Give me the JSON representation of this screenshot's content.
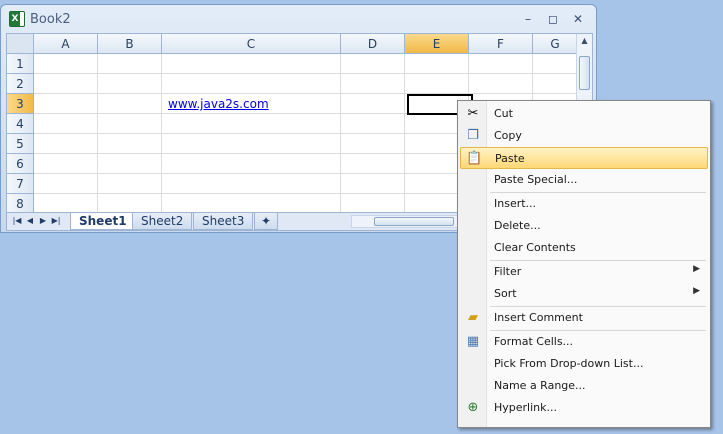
{
  "window": {
    "title": "Book2",
    "buttons": [
      "–",
      "◻",
      "✕"
    ]
  },
  "grid": {
    "columns": [
      "A",
      "B",
      "C",
      "D",
      "E",
      "F",
      "G"
    ],
    "rows": [
      "1",
      "2",
      "3",
      "4",
      "5",
      "6",
      "7",
      "8"
    ],
    "selected_column": "E",
    "selected_row": "3",
    "cells": {
      "C3": "www.java2s.com"
    }
  },
  "sheet_tabs": [
    "Sheet1",
    "Sheet2",
    "Sheet3"
  ],
  "active_sheet": "Sheet1",
  "nav_icons": [
    "first-sheet-icon",
    "prev-sheet-icon",
    "next-sheet-icon",
    "last-sheet-icon"
  ],
  "context_menu": {
    "items": [
      {
        "label": "Cut",
        "icon": "scissors-icon"
      },
      {
        "label": "Copy",
        "icon": "copy-icon"
      },
      {
        "label": "Paste",
        "icon": "paste-icon",
        "highlighted": true
      },
      {
        "label": "Paste Special..."
      },
      {
        "label": "Insert..."
      },
      {
        "label": "Delete..."
      },
      {
        "label": "Clear Contents"
      },
      {
        "label": "Filter",
        "submenu": true
      },
      {
        "label": "Sort",
        "submenu": true
      },
      {
        "label": "Insert Comment",
        "icon": "comment-icon"
      },
      {
        "label": "Format Cells...",
        "icon": "format-cells-icon"
      },
      {
        "label": "Pick From Drop-down List..."
      },
      {
        "label": "Name a Range..."
      },
      {
        "label": "Hyperlink...",
        "icon": "hyperlink-icon"
      }
    ]
  },
  "colors": {
    "highlight": "#ffd876",
    "selected_header": "#f1b948",
    "link": "#0000ee"
  }
}
